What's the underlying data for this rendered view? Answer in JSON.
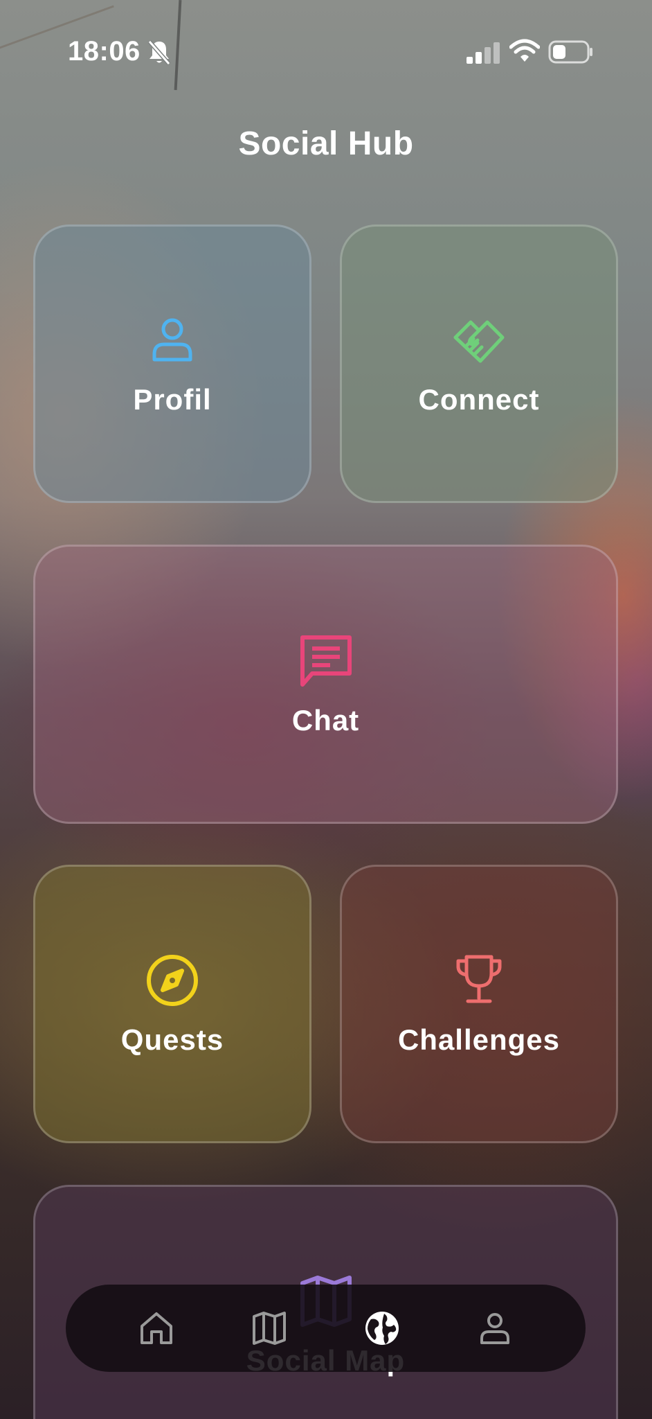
{
  "status_bar": {
    "time": "18:06",
    "icons": [
      "bell-slash-icon",
      "cellular-signal-icon",
      "wifi-icon",
      "battery-icon"
    ]
  },
  "header": {
    "title": "Social Hub"
  },
  "tiles": [
    {
      "label": "Profil",
      "icon": "person-icon",
      "icon_color": "#4fb3f0"
    },
    {
      "label": "Connect",
      "icon": "handshake-icon",
      "icon_color": "#6fcf7a"
    },
    {
      "label": "Chat",
      "icon": "chat-bubble-icon",
      "icon_color": "#e8457a"
    },
    {
      "label": "Quests",
      "icon": "compass-icon",
      "icon_color": "#f2d21b"
    },
    {
      "label": "Challenges",
      "icon": "trophy-icon",
      "icon_color": "#ee6e6e"
    },
    {
      "label": "Social Map",
      "icon": "map-icon",
      "icon_color": "#9b7ad8"
    }
  ],
  "bottom_nav": {
    "items": [
      {
        "icon": "home-icon",
        "active": false
      },
      {
        "icon": "map-icon",
        "active": false
      },
      {
        "icon": "globe-icon",
        "active": true
      },
      {
        "icon": "profile-icon",
        "active": false
      }
    ],
    "active_color": "#ffffff",
    "inactive_color": "#9a9a9a"
  }
}
